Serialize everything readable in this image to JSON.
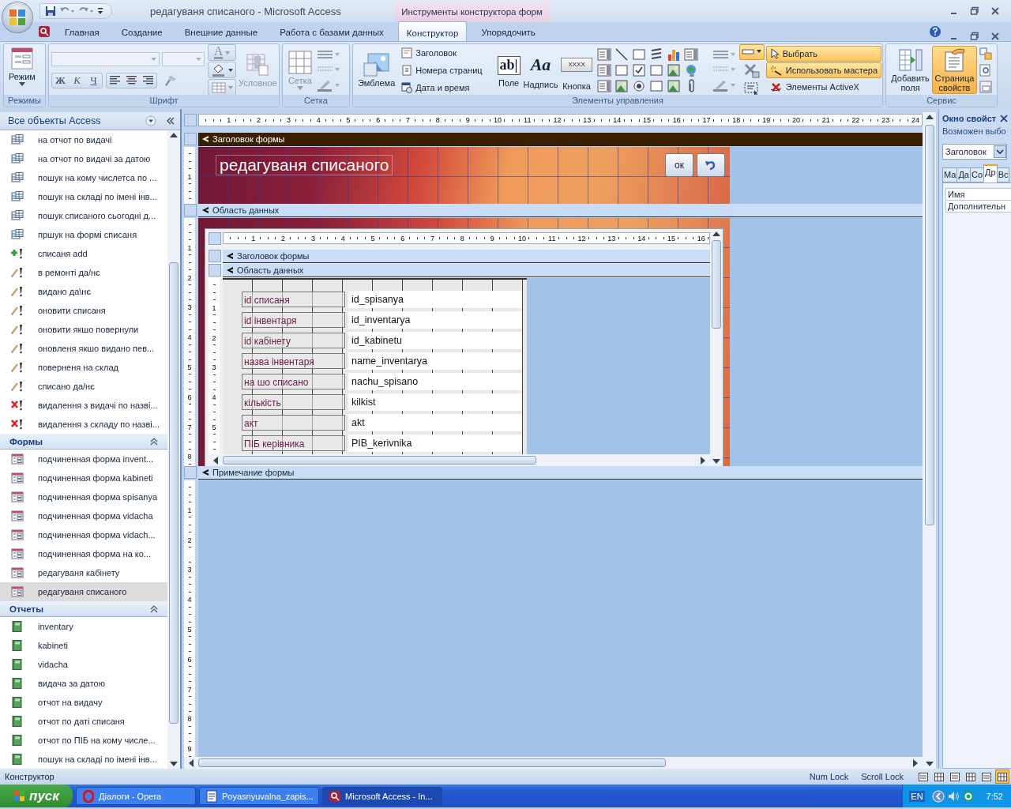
{
  "window": {
    "title": "редагуваня списаного - Microsoft Access",
    "context_tab": "Инструменты конструктора форм"
  },
  "ribbon_tabs": [
    {
      "label": "Главная",
      "selected": false
    },
    {
      "label": "Создание",
      "selected": false
    },
    {
      "label": "Внешние данные",
      "selected": false
    },
    {
      "label": "Работа с базами данных",
      "selected": false
    },
    {
      "label": "Конструктор",
      "selected": true
    },
    {
      "label": "Упорядочить",
      "selected": false
    }
  ],
  "ribbon": {
    "modes": {
      "label": "Режимы",
      "button": "Режим"
    },
    "font": {
      "label": "Шрифт",
      "bold": "Ж",
      "italic": "К",
      "underline": "Ч",
      "color_glyph": "A",
      "conditional": {
        "label": "Условное",
        "disabled": true
      }
    },
    "grid": {
      "label": "Сетка",
      "button": {
        "label": "Сетка",
        "disabled": true
      }
    },
    "controls": {
      "label": "Элементы управления",
      "logo": "Эмблема",
      "small": [
        {
          "label": "Заголовок",
          "kind": "title"
        },
        {
          "label": "Номера страниц",
          "kind": "page"
        },
        {
          "label": "Дата и время",
          "kind": "date"
        }
      ],
      "big": [
        {
          "label": "Поле",
          "glyph": "ab|",
          "kind": "textbox"
        },
        {
          "label": "Надпись",
          "glyph": "Aa",
          "kind": "label"
        },
        {
          "label": "Кнопка",
          "glyph": "XXXX",
          "kind": "button"
        }
      ],
      "select": {
        "label": "Выбрать",
        "on": true
      },
      "wizard": {
        "label": "Использовать мастера",
        "on": true
      },
      "activex": "Элементы ActiveX"
    },
    "tools": {
      "label": "Сервис",
      "add_fields": "Добавить поля",
      "property_sheet": {
        "label": "Страница свойств",
        "on": true
      }
    }
  },
  "nav": {
    "title": "Все объекты Access",
    "sections": [
      {
        "items": [
          {
            "label": "на отчот по видачі",
            "kind": "select",
            "selected": false
          },
          {
            "label": "на отчот по видачі за датою",
            "kind": "select",
            "selected": false
          },
          {
            "label": "пошук на кому числетса по ...",
            "kind": "select",
            "selected": false
          },
          {
            "label": "пошук на складі по імені інв...",
            "kind": "select",
            "selected": false
          },
          {
            "label": "пошук списаного сьогодні д...",
            "kind": "select",
            "selected": false
          },
          {
            "label": "пршук на формі списаня",
            "kind": "select",
            "selected": false
          },
          {
            "label": "списаня add",
            "kind": "append",
            "selected": false
          },
          {
            "label": "в ремонті да/нє",
            "kind": "update",
            "selected": false
          },
          {
            "label": "видано да\\нє",
            "kind": "update",
            "selected": false
          },
          {
            "label": "оновити списаня",
            "kind": "update",
            "selected": false
          },
          {
            "label": "оновити якшо повернули",
            "kind": "update",
            "selected": false
          },
          {
            "label": "оновленя якшо видано пев...",
            "kind": "update",
            "selected": false
          },
          {
            "label": "поверненя на склад",
            "kind": "update",
            "selected": false
          },
          {
            "label": "списано да/нє",
            "kind": "update",
            "selected": false
          },
          {
            "label": "видалення з видачі по назві...",
            "kind": "delete",
            "selected": false
          },
          {
            "label": "видалення з складу по назві...",
            "kind": "delete",
            "selected": false
          }
        ]
      },
      {
        "header": "Формы",
        "items": [
          {
            "label": "подчиненная форма invent...",
            "kind": "form",
            "selected": false
          },
          {
            "label": "подчиненная форма kabineti",
            "kind": "form",
            "selected": false
          },
          {
            "label": "подчиненная форма spisanya",
            "kind": "form",
            "selected": false
          },
          {
            "label": "подчиненная форма vidacha",
            "kind": "form",
            "selected": false
          },
          {
            "label": "подчиненная форма vidach...",
            "kind": "form",
            "selected": false
          },
          {
            "label": "подчиненная форма на ко...",
            "kind": "form",
            "selected": false
          },
          {
            "label": "редагуваня кабінету",
            "kind": "form",
            "selected": false
          },
          {
            "label": "редагуваня списаного",
            "kind": "form",
            "selected": true
          }
        ]
      },
      {
        "header": "Отчеты",
        "items": [
          {
            "label": "inventary",
            "kind": "report",
            "selected": false
          },
          {
            "label": "kabineti",
            "kind": "report",
            "selected": false
          },
          {
            "label": "vidacha",
            "kind": "report",
            "selected": false
          },
          {
            "label": "видача за датою",
            "kind": "report",
            "selected": false
          },
          {
            "label": "отчот на видачу",
            "kind": "report",
            "selected": false
          },
          {
            "label": "отчот по даті списаня",
            "kind": "report",
            "selected": false
          },
          {
            "label": "отчот по ПІБ на кому числе...",
            "kind": "report",
            "selected": false
          },
          {
            "label": "пошук на складі по імені інв...",
            "kind": "report",
            "selected": false
          }
        ]
      }
    ]
  },
  "design": {
    "ruler": [
      "1",
      "2",
      "3",
      "4",
      "5",
      "6",
      "7",
      "8",
      "9",
      "10",
      "11",
      "12",
      "13",
      "14",
      "15",
      "16",
      "17",
      "18",
      "19",
      "20",
      "21",
      "22",
      "23",
      "24"
    ],
    "sections": [
      {
        "title": "Заголовок формы",
        "kind": "header",
        "ruler": [
          "1"
        ]
      },
      {
        "title": "Область данных",
        "kind": "detail",
        "ruler": [
          "1",
          "2",
          "3",
          "4",
          "5",
          "6",
          "7",
          "8"
        ]
      },
      {
        "title": "Примечание формы",
        "kind": "footer",
        "ruler": [
          "1",
          "2",
          "3",
          "4",
          "5",
          "6",
          "7",
          "8",
          "9"
        ]
      }
    ],
    "form_title": "редагуваня списаного",
    "ok_button": "ок",
    "subform": {
      "ruler": [
        "1",
        "2",
        "3",
        "4",
        "5",
        "6",
        "7",
        "8",
        "9",
        "10",
        "11",
        "12",
        "13",
        "14",
        "15",
        "16"
      ],
      "sections": [
        "Заголовок формы",
        "Область данных"
      ],
      "vruler": [
        "1",
        "2",
        "3",
        "4",
        "5"
      ],
      "fields": [
        {
          "label": "id списаня",
          "field": "id_spisanya"
        },
        {
          "label": "id інвентаря",
          "field": "id_inventarya"
        },
        {
          "label": "id кабінету",
          "field": "id_kabinetu"
        },
        {
          "label": "назва інвентаря",
          "field": "name_inventarya"
        },
        {
          "label": "на шо списано",
          "field": "nachu_spisano"
        },
        {
          "label": "кількість",
          "field": "kilkist"
        },
        {
          "label": "акт",
          "field": "akt"
        },
        {
          "label": "ПІБ керівника",
          "field": "PIB_kerivnika"
        }
      ]
    }
  },
  "property_sheet": {
    "title": "Окно свойст",
    "subtitle": "Возможен выбо",
    "selector": "Заголовок",
    "tabs": [
      {
        "label": "Ма",
        "selected": false
      },
      {
        "label": "Да",
        "selected": false
      },
      {
        "label": "Со",
        "selected": false
      },
      {
        "label": "Др",
        "selected": true
      },
      {
        "label": "Вс",
        "selected": false
      }
    ],
    "rows": [
      "Имя",
      "Дополнительн"
    ]
  },
  "status_bar": {
    "mode": "Конструктор",
    "indicators": [
      "Num Lock",
      "Scroll Lock"
    ],
    "views": [
      {
        "selected": false
      },
      {
        "selected": false
      },
      {
        "selected": false
      },
      {
        "selected": false
      },
      {
        "selected": false
      },
      {
        "selected": true
      }
    ]
  },
  "taskbar": {
    "start": "пуск",
    "tasks": [
      {
        "label": "Діалоги - Opera",
        "kind": "opera",
        "selected": false
      },
      {
        "label": "Poyasnyuvalna_zapis...",
        "kind": "document",
        "selected": false
      },
      {
        "label": "Microsoft Access - In...",
        "kind": "access",
        "selected": true
      }
    ],
    "language": "EN",
    "time": "7:52"
  }
}
